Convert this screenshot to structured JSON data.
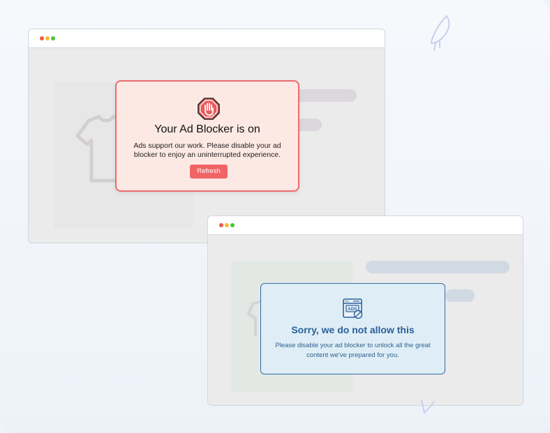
{
  "window_top": {
    "dots": [
      "close",
      "minimize",
      "maximize"
    ]
  },
  "adblock_modal": {
    "icon": "stop-hand-icon",
    "title": "Your Ad Blocker is on",
    "body": "Ads support our work. Please disable your ad blocker to enjoy an uninterrupted experience.",
    "button_label": "Refresh",
    "accent_color": "#ef6566",
    "background_color": "#fde9e4"
  },
  "window_bottom": {
    "dots": [
      "close",
      "minimize",
      "maximize"
    ]
  },
  "sorry_modal": {
    "icon": "ads-blocked-browser-icon",
    "title": "Sorry, we do not allow this",
    "body": "Please disable your ad blocker to unlock all the great content we've prepared for you.",
    "accent_color": "#2a5f98",
    "background_color": "#dfeef6"
  }
}
